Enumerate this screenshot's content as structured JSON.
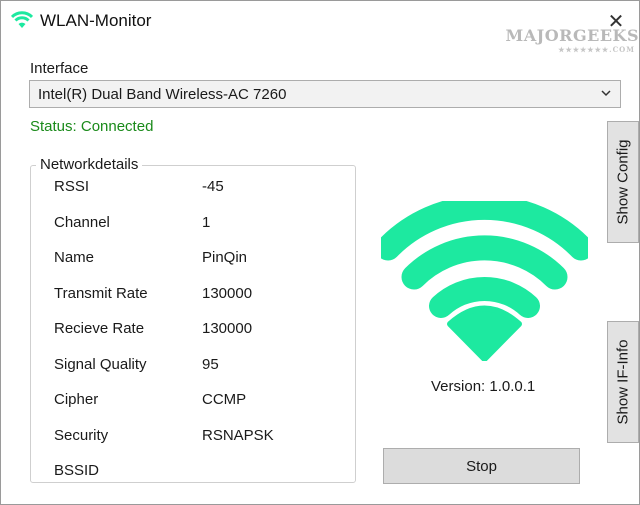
{
  "window": {
    "title": "WLAN-Monitor",
    "close_glyph": "✕"
  },
  "icons": {
    "app_icon": "wifi-icon",
    "close_icon": "close-icon",
    "dropdown_icon": "chevron-down-icon"
  },
  "watermark": {
    "text": "MAJORGEEKS",
    "stars": "★★★★★★★.COM"
  },
  "interface": {
    "label": "Interface",
    "selected": "Intel(R) Dual Band Wireless-AC 7260"
  },
  "status": {
    "text": "Status: Connected",
    "color": "#1a8a1a"
  },
  "network_details": {
    "title": "Networkdetails",
    "rows": [
      {
        "label": "RSSI",
        "value": "-45"
      },
      {
        "label": "Channel",
        "value": "1"
      },
      {
        "label": "Name",
        "value": "PinQin"
      },
      {
        "label": "Transmit Rate",
        "value": "130000"
      },
      {
        "label": "Recieve Rate",
        "value": "130000"
      },
      {
        "label": "Signal Quality",
        "value": "95"
      },
      {
        "label": "Cipher",
        "value": "CCMP"
      },
      {
        "label": "Security",
        "value": "RSNAPSK"
      },
      {
        "label": "BSSID",
        "value": ""
      }
    ]
  },
  "signal_icon_color": "#1de9a0",
  "version": "Version: 1.0.0.1",
  "buttons": {
    "stop": "Stop",
    "show_config": "Show Config",
    "show_if_info": "Show IF-Info"
  }
}
